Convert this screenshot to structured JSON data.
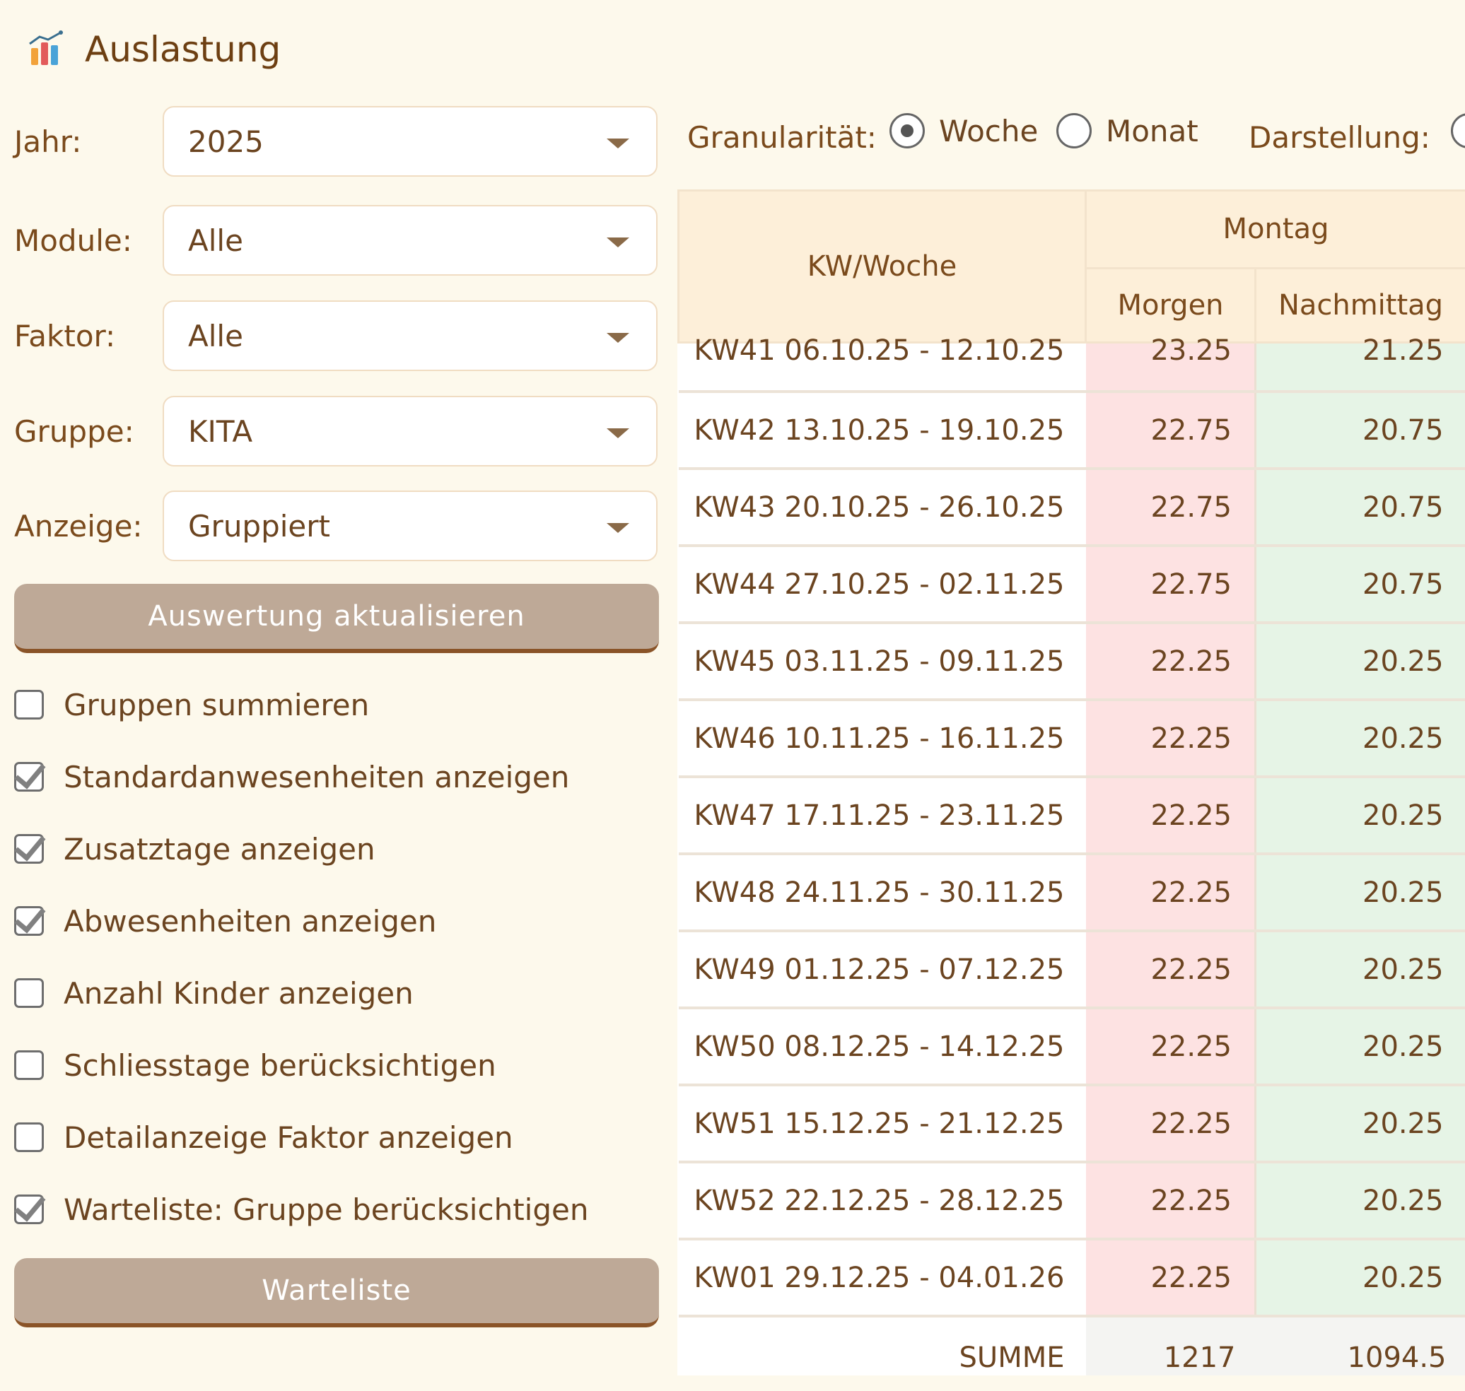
{
  "header": {
    "title": "Auslastung",
    "icon": "bar-chart-icon"
  },
  "filters": {
    "jahr": {
      "label": "Jahr:",
      "value": "2025"
    },
    "module": {
      "label": "Module:",
      "value": "Alle"
    },
    "faktor": {
      "label": "Faktor:",
      "value": "Alle"
    },
    "gruppe": {
      "label": "Gruppe:",
      "value": "KITA"
    },
    "anzeige": {
      "label": "Anzeige:",
      "value": "Gruppiert"
    }
  },
  "buttons": {
    "update": "Auswertung aktualisieren",
    "waitlist": "Warteliste"
  },
  "options": [
    {
      "label": "Gruppen summieren",
      "checked": false
    },
    {
      "label": "Standardanwesenheiten anzeigen",
      "checked": true
    },
    {
      "label": "Zusatztage anzeigen",
      "checked": true
    },
    {
      "label": "Abwesenheiten anzeigen",
      "checked": true
    },
    {
      "label": "Anzahl Kinder anzeigen",
      "checked": false
    },
    {
      "label": "Schliesstage berücksichtigen",
      "checked": false
    },
    {
      "label": "Detailanzeige Faktor anzeigen",
      "checked": false
    },
    {
      "label": "Warteliste: Gruppe berücksichtigen",
      "checked": true
    }
  ],
  "granularity": {
    "label": "Granularität:",
    "options": [
      {
        "label": "Woche",
        "selected": true
      },
      {
        "label": "Monat",
        "selected": false
      }
    ]
  },
  "darstellung": {
    "label": "Darstellung:"
  },
  "table": {
    "col_kw": "KW/Woche",
    "day": "Montag",
    "col_morning": "Morgen",
    "col_afternoon": "Nachmittag",
    "rows": [
      {
        "kw": "KW41 06.10.25 - 12.10.25",
        "morgen": "23.25",
        "nachmittag": "21.25"
      },
      {
        "kw": "KW42 13.10.25 - 19.10.25",
        "morgen": "22.75",
        "nachmittag": "20.75"
      },
      {
        "kw": "KW43 20.10.25 - 26.10.25",
        "morgen": "22.75",
        "nachmittag": "20.75"
      },
      {
        "kw": "KW44 27.10.25 - 02.11.25",
        "morgen": "22.75",
        "nachmittag": "20.75"
      },
      {
        "kw": "KW45 03.11.25 - 09.11.25",
        "morgen": "22.25",
        "nachmittag": "20.25"
      },
      {
        "kw": "KW46 10.11.25 - 16.11.25",
        "morgen": "22.25",
        "nachmittag": "20.25"
      },
      {
        "kw": "KW47 17.11.25 - 23.11.25",
        "morgen": "22.25",
        "nachmittag": "20.25"
      },
      {
        "kw": "KW48 24.11.25 - 30.11.25",
        "morgen": "22.25",
        "nachmittag": "20.25"
      },
      {
        "kw": "KW49 01.12.25 - 07.12.25",
        "morgen": "22.25",
        "nachmittag": "20.25"
      },
      {
        "kw": "KW50 08.12.25 - 14.12.25",
        "morgen": "22.25",
        "nachmittag": "20.25"
      },
      {
        "kw": "KW51 15.12.25 - 21.12.25",
        "morgen": "22.25",
        "nachmittag": "20.25"
      },
      {
        "kw": "KW52 22.12.25 - 28.12.25",
        "morgen": "22.25",
        "nachmittag": "20.25"
      },
      {
        "kw": "KW01 29.12.25 - 04.01.26",
        "morgen": "22.25",
        "nachmittag": "20.25"
      }
    ],
    "sum": {
      "label": "SUMME",
      "morgen": "1217",
      "nachmittag": "1094.5"
    }
  }
}
